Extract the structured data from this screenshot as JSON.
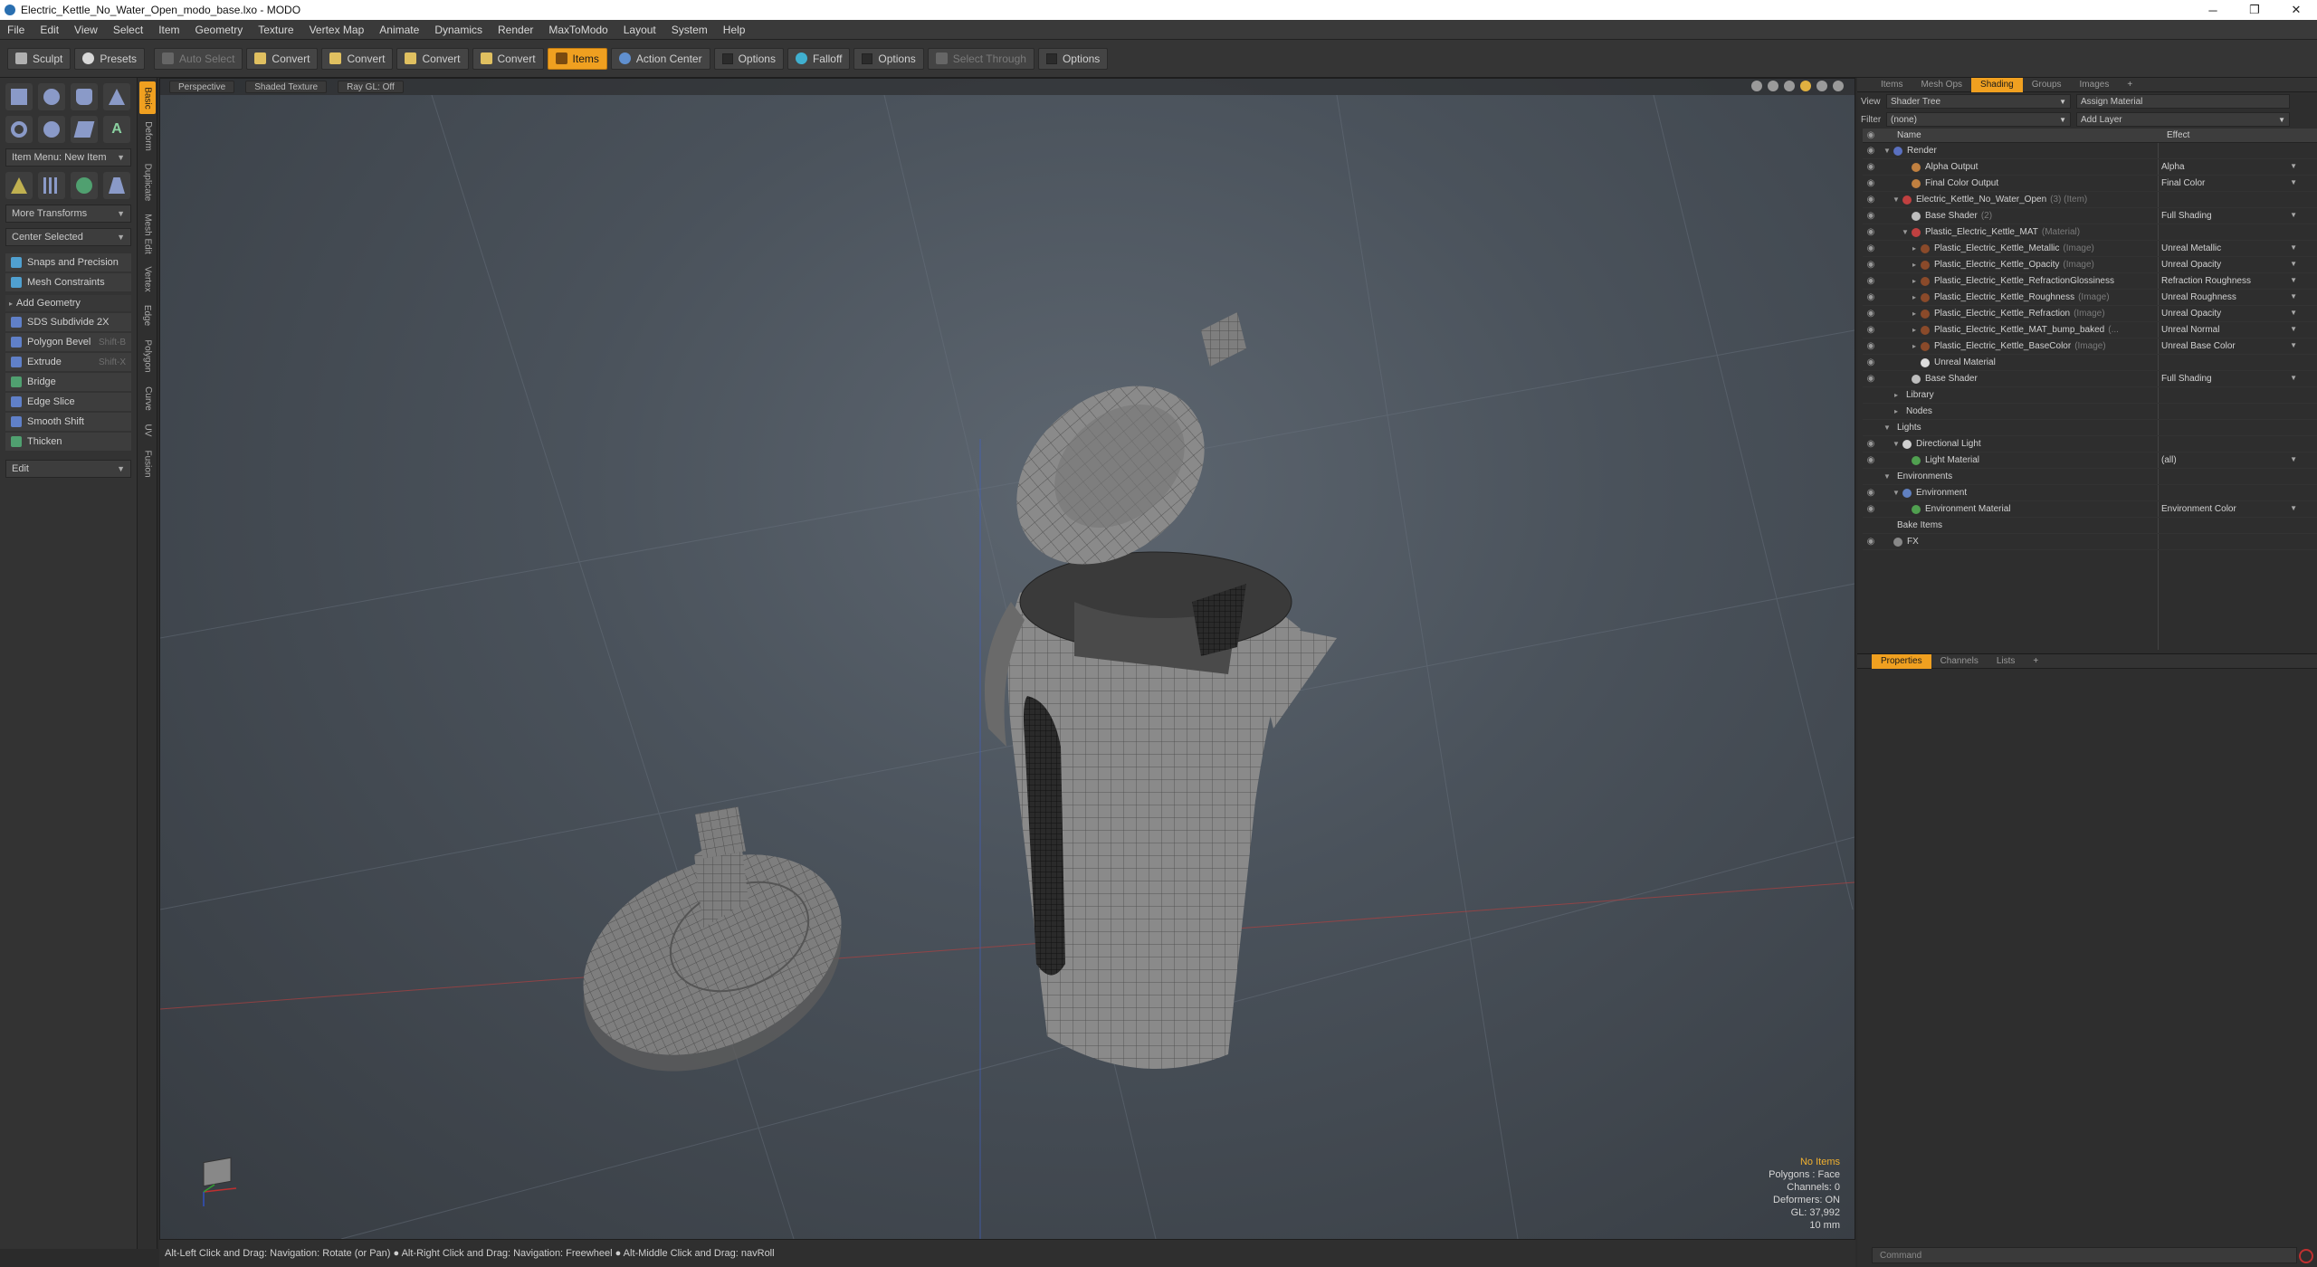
{
  "window": {
    "title": "Electric_Kettle_No_Water_Open_modo_base.lxo - MODO",
    "min_glyph": "─",
    "max_glyph": "❐",
    "close_glyph": "✕"
  },
  "menu": [
    "File",
    "Edit",
    "View",
    "Select",
    "Item",
    "Geometry",
    "Texture",
    "Vertex Map",
    "Animate",
    "Dynamics",
    "Render",
    "MaxToModo",
    "Layout",
    "System",
    "Help"
  ],
  "toolbar": {
    "sculpt": "Sculpt",
    "presets": "Presets",
    "auto_select": "Auto Select",
    "convert1": "Convert",
    "convert2": "Convert",
    "convert3": "Convert",
    "convert4": "Convert",
    "items": "Items",
    "action_center": "Action Center",
    "options1": "Options",
    "falloff": "Falloff",
    "options2": "Options",
    "select_through": "Select Through",
    "options3": "Options"
  },
  "left": {
    "item_menu": "Item Menu: New Item",
    "more_transforms": "More Transforms",
    "center_selected": "Center Selected",
    "snaps": "Snaps and Precision",
    "mesh_constraints": "Mesh Constraints",
    "add_geometry": "Add Geometry",
    "tools": [
      {
        "label": "SDS Subdivide 2X",
        "short": ""
      },
      {
        "label": "Polygon Bevel",
        "short": "Shift-B"
      },
      {
        "label": "Extrude",
        "short": "Shift-X"
      },
      {
        "label": "Bridge",
        "short": ""
      },
      {
        "label": "Edge Slice",
        "short": ""
      },
      {
        "label": "Smooth Shift",
        "short": ""
      },
      {
        "label": "Thicken",
        "short": ""
      }
    ],
    "edit": "Edit"
  },
  "vtabs": [
    "Basic",
    "Deform",
    "Duplicate",
    "Mesh Edit",
    "Vertex",
    "Edge",
    "Polygon",
    "Curve",
    "UV",
    "Fusion"
  ],
  "viewport": {
    "perspective": "Perspective",
    "shaded": "Shaded Texture",
    "raygl": "Ray GL: Off",
    "hud": {
      "no_items": "No Items",
      "polygons": "Polygons : Face",
      "channels": "Channels: 0",
      "deformers": "Deformers: ON",
      "gl": "GL: 37,992",
      "scale": "10 mm"
    }
  },
  "status": "Alt-Left Click and Drag: Navigation: Rotate (or Pan) ● Alt-Right Click and Drag: Navigation: Freewheel ● Alt-Middle Click and Drag: navRoll",
  "right": {
    "tabs": [
      "Items",
      "Mesh Ops",
      "Shading",
      "Groups",
      "Images",
      "+"
    ],
    "view_label": "View",
    "view_value": "Shader Tree",
    "assign_material": "Assign Material",
    "filter_label": "Filter",
    "filter_value": "(none)",
    "add_layer": "Add Layer",
    "col_name": "Name",
    "col_effect": "Effect",
    "tree": [
      {
        "indent": 0,
        "tw": "▼",
        "name": "Render",
        "sub": "",
        "effect": "",
        "color": "#5a70c0"
      },
      {
        "indent": 2,
        "tw": "",
        "name": "Alpha Output",
        "sub": "",
        "effect": "Alpha",
        "color": "#c08040"
      },
      {
        "indent": 2,
        "tw": "",
        "name": "Final Color Output",
        "sub": "",
        "effect": "Final Color",
        "color": "#c08040"
      },
      {
        "indent": 1,
        "tw": "▼",
        "name": "Electric_Kettle_No_Water_Open",
        "sub": "(3) (Item)",
        "effect": "",
        "color": "#c04040"
      },
      {
        "indent": 2,
        "tw": "",
        "name": "Base Shader",
        "sub": "(2)",
        "effect": "Full Shading",
        "color": "#bdbdbd"
      },
      {
        "indent": 2,
        "tw": "▼",
        "name": "Plastic_Electric_Kettle_MAT",
        "sub": "(Material)",
        "effect": "",
        "color": "#c04040"
      },
      {
        "indent": 3,
        "tw": "▸",
        "name": "Plastic_Electric_Kettle_Metallic",
        "sub": "(Image)",
        "effect": "Unreal Metallic",
        "color": "#8a4a2a"
      },
      {
        "indent": 3,
        "tw": "▸",
        "name": "Plastic_Electric_Kettle_Opacity",
        "sub": "(Image)",
        "effect": "Unreal Opacity",
        "color": "#8a4a2a"
      },
      {
        "indent": 3,
        "tw": "▸",
        "name": "Plastic_Electric_Kettle_RefractionGlossiness",
        "sub": "",
        "effect": "Refraction Roughness",
        "color": "#8a4a2a"
      },
      {
        "indent": 3,
        "tw": "▸",
        "name": "Plastic_Electric_Kettle_Roughness",
        "sub": "(Image)",
        "effect": "Unreal Roughness",
        "color": "#8a4a2a"
      },
      {
        "indent": 3,
        "tw": "▸",
        "name": "Plastic_Electric_Kettle_Refraction",
        "sub": "(Image)",
        "effect": "Unreal Opacity",
        "color": "#8a4a2a"
      },
      {
        "indent": 3,
        "tw": "▸",
        "name": "Plastic_Electric_Kettle_MAT_bump_baked",
        "sub": "(...",
        "effect": "Unreal Normal",
        "color": "#8a4a2a"
      },
      {
        "indent": 3,
        "tw": "▸",
        "name": "Plastic_Electric_Kettle_BaseColor",
        "sub": "(Image)",
        "effect": "Unreal Base Color",
        "color": "#8a4a2a"
      },
      {
        "indent": 3,
        "tw": "",
        "name": "Unreal Material",
        "sub": "",
        "effect": "",
        "color": "#dcdcdc"
      },
      {
        "indent": 2,
        "tw": "",
        "name": "Base Shader",
        "sub": "",
        "effect": "Full Shading",
        "color": "#bdbdbd"
      },
      {
        "indent": 1,
        "tw": "▸",
        "name": "Library",
        "sub": "",
        "effect": "",
        "color": ""
      },
      {
        "indent": 1,
        "tw": "▸",
        "name": "Nodes",
        "sub": "",
        "effect": "",
        "color": ""
      },
      {
        "indent": 0,
        "tw": "▼",
        "name": "Lights",
        "sub": "",
        "effect": "",
        "color": ""
      },
      {
        "indent": 1,
        "tw": "▼",
        "name": "Directional Light",
        "sub": "",
        "effect": "",
        "color": "#d0d0d0"
      },
      {
        "indent": 2,
        "tw": "",
        "name": "Light Material",
        "sub": "",
        "effect": "(all)",
        "color": "#50a050"
      },
      {
        "indent": 0,
        "tw": "▼",
        "name": "Environments",
        "sub": "",
        "effect": "",
        "color": ""
      },
      {
        "indent": 1,
        "tw": "▼",
        "name": "Environment",
        "sub": "",
        "effect": "",
        "color": "#6080c0"
      },
      {
        "indent": 2,
        "tw": "",
        "name": "Environment Material",
        "sub": "",
        "effect": "Environment Color",
        "color": "#50a050"
      },
      {
        "indent": 0,
        "tw": "",
        "name": "Bake Items",
        "sub": "",
        "effect": "",
        "color": ""
      },
      {
        "indent": 0,
        "tw": "",
        "name": "FX",
        "sub": "",
        "effect": "",
        "color": "#888888"
      }
    ],
    "props_tabs": [
      "Properties",
      "Channels",
      "Lists",
      "+"
    ],
    "command_placeholder": "Command"
  }
}
